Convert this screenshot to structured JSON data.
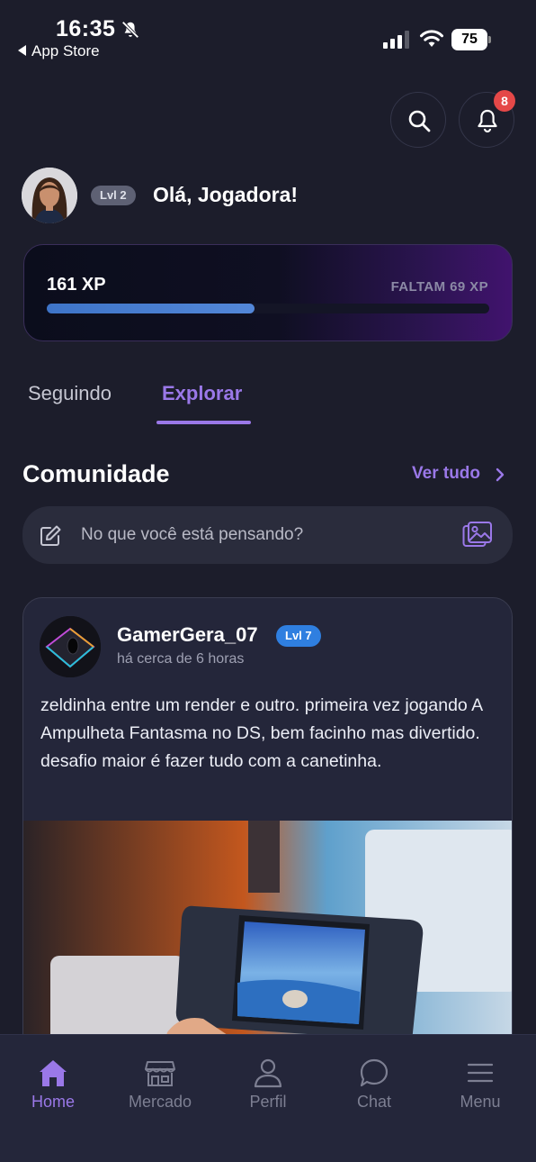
{
  "status_bar": {
    "time": "16:35",
    "back_label": "App Store",
    "battery": "75"
  },
  "header": {
    "search_icon": "search-icon",
    "notifications_icon": "bell-icon",
    "notifications_count": "8"
  },
  "profile": {
    "level": "Lvl 2",
    "greeting": "Olá, Jogadora!"
  },
  "xp": {
    "current": "161 XP",
    "remaining": "FALTAM 69 XP",
    "progress_fraction": 0.47
  },
  "tabs": [
    {
      "label": "Seguindo",
      "active": false
    },
    {
      "label": "Explorar",
      "active": true
    }
  ],
  "community": {
    "title": "Comunidade",
    "see_all": "Ver tudo",
    "compose_placeholder": "No que você está pensando?"
  },
  "post": {
    "username": "GamerGera_07",
    "level": "Lvl 7",
    "time": "há cerca de 6 horas",
    "text": "zeldinha entre um render e outro. primeira vez jogando A Ampulheta Fantasma no DS, bem facinho mas divertido. desafio maior é fazer tudo com a canetinha."
  },
  "bottom_nav": [
    {
      "label": "Home",
      "icon": "home-icon",
      "active": true
    },
    {
      "label": "Mercado",
      "icon": "store-icon",
      "active": false
    },
    {
      "label": "Perfil",
      "icon": "user-icon",
      "active": false
    },
    {
      "label": "Chat",
      "icon": "chat-icon",
      "active": false
    },
    {
      "label": "Menu",
      "icon": "menu-icon",
      "active": false
    }
  ],
  "colors": {
    "background": "#1c1d2b",
    "accent": "#9a78e8",
    "badge": "#e54848",
    "level_badge": "#2f7fe0",
    "xp_bar": "#4a7fd0"
  }
}
